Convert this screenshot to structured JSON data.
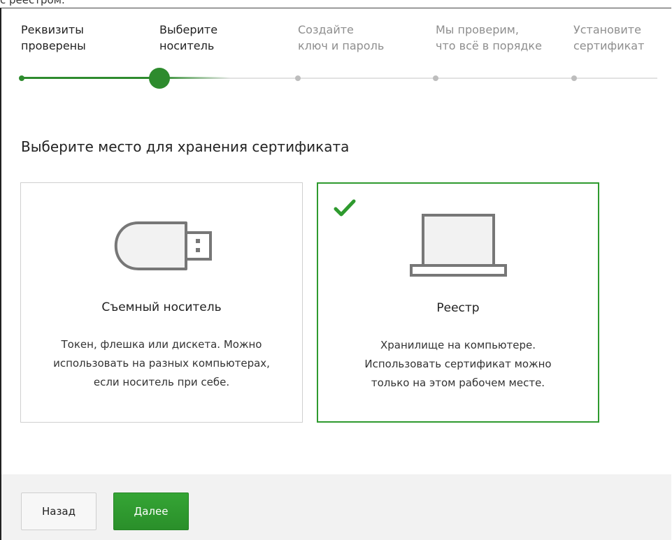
{
  "caption": "с реестром.",
  "steps": [
    {
      "line1": "Реквизиты",
      "line2": "проверены",
      "state": "done"
    },
    {
      "line1": "Выберите",
      "line2": "носитель",
      "state": "current"
    },
    {
      "line1": "Создайте",
      "line2": "ключ и пароль",
      "state": "pending"
    },
    {
      "line1": "Мы проверим,",
      "line2": "что всё в порядке",
      "state": "pending"
    },
    {
      "line1": "Установите",
      "line2": "сертификат",
      "state": "pending"
    }
  ],
  "heading": "Выберите место для хранения сертификата",
  "options": {
    "usb": {
      "title": "Съемный носитель",
      "desc": [
        "Токен, флешка или дискета. Можно",
        "использовать на разных компьютерах,",
        "если носитель при себе."
      ],
      "icon": "usb-drive-icon",
      "selected": false
    },
    "registry": {
      "title": "Реестр",
      "desc": [
        "Хранилище на компьютере.",
        "Использовать сертификат можно",
        "только на этом рабочем месте."
      ],
      "icon": "laptop-icon",
      "selected": true
    }
  },
  "footer": {
    "back_label": "Назад",
    "next_label": "Далее"
  },
  "colors": {
    "accent": "#2e9a2e",
    "inactive_text": "#8e8e8e",
    "footer_bg": "#f2f2f2"
  }
}
